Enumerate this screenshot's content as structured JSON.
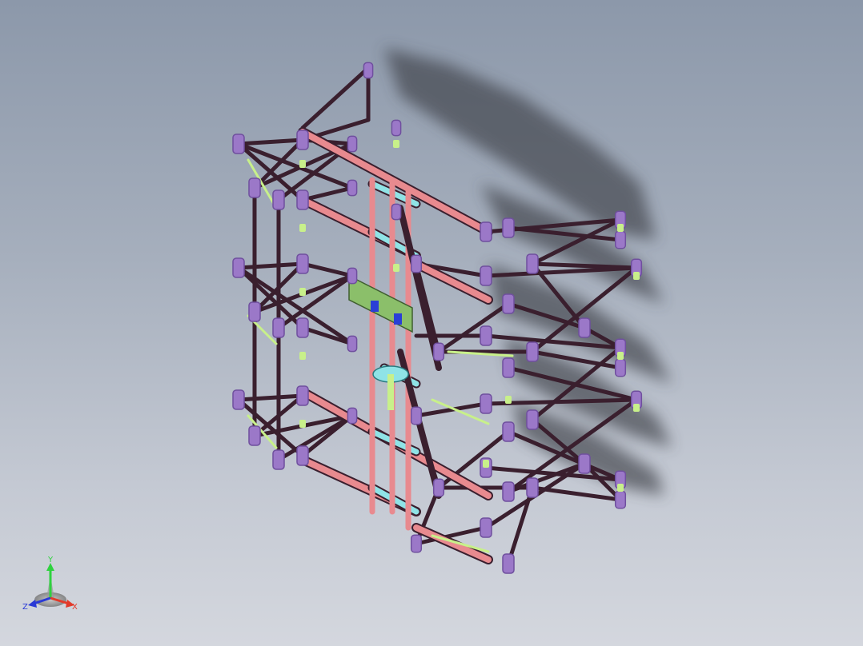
{
  "viewport": {
    "background_top": "#8c98aa",
    "background_bottom": "#d4d7de",
    "colors": {
      "truss_frame": "#3a1f2e",
      "connector": "#9b78c8",
      "connector_dark": "#6f4f9e",
      "rail_red": "#e88a8f",
      "rail_cyan": "#8fe3e6",
      "joint_green": "#c8f08a",
      "gearbox_green": "#8bbf6a",
      "motor_blue": "#2a3fd6",
      "shadow": "#3c3f46"
    }
  },
  "triad": {
    "y_label": "Y",
    "x_label": "X",
    "z_label": "Z",
    "y_color": "#2fd23f",
    "x_color": "#e23a2a",
    "z_color": "#2a3ad6"
  }
}
